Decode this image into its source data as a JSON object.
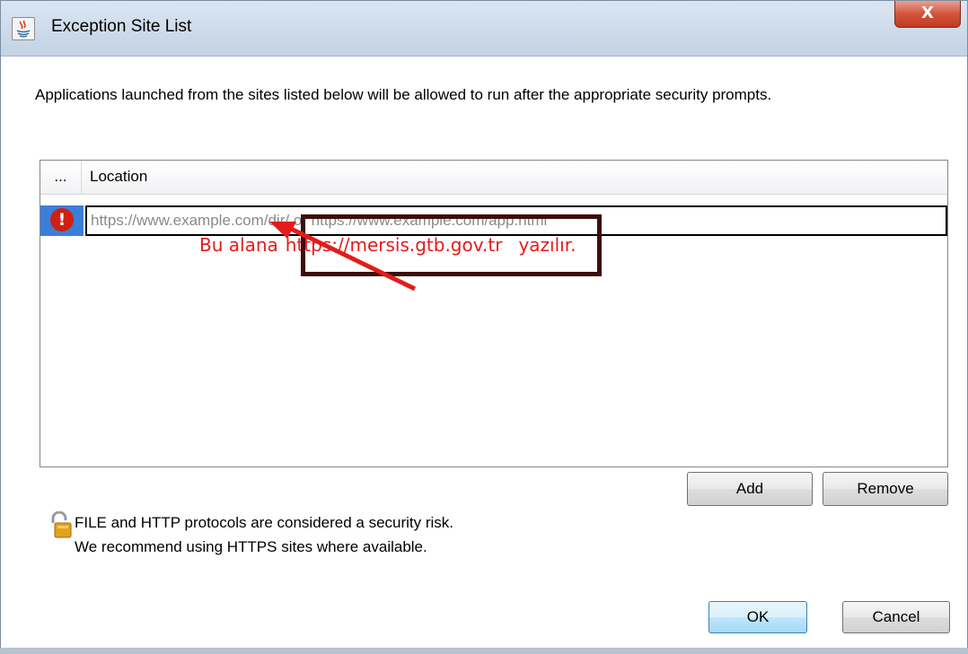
{
  "window": {
    "title": "Exception Site List",
    "close_label": "X"
  },
  "description": "Applications launched from the sites listed below will be allowed to run after the appropriate security prompts.",
  "table": {
    "headers": [
      "...",
      "Location"
    ],
    "row": {
      "status_glyph": "!",
      "value": "",
      "placeholder": "https://www.example.com/dir/ or https://www.example.com/app.html"
    }
  },
  "annotation": {
    "prefix": "Bu alana",
    "url": "https://mersis.gtb.gov.tr",
    "suffix": "yazılır."
  },
  "buttons": {
    "add": "Add",
    "remove": "Remove",
    "ok": "OK",
    "cancel": "Cancel"
  },
  "security_note": {
    "line1": "FILE and HTTP protocols are considered a security risk.",
    "line2": "We recommend using HTTPS sites where available."
  },
  "icons": {
    "app": "java-icon",
    "row_status": "error-icon",
    "security": "lock-icon"
  },
  "colors": {
    "annotation_red": "#e41b1b",
    "selection_blue": "#3c7fd8",
    "error_red": "#d11f10"
  }
}
